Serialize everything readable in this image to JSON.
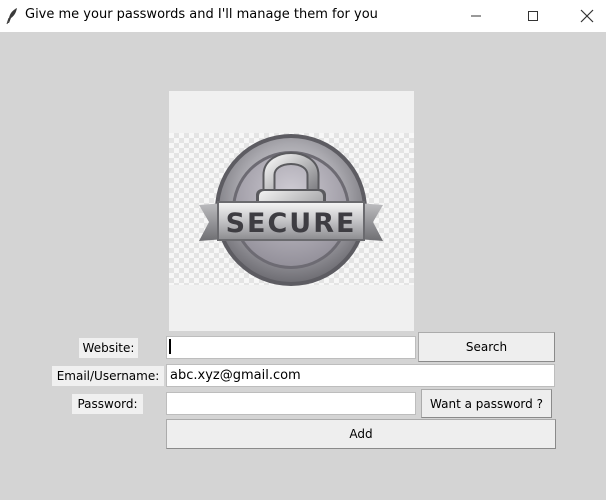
{
  "window": {
    "title": "Give me your passwords and I'll manage them for you"
  },
  "logo": {
    "text": "SECURE",
    "icon": "padlock-badge"
  },
  "form": {
    "website_label": "Website:",
    "website_value": "",
    "email_label": "Email/Username:",
    "email_value": "abc.xyz@gmail.com",
    "password_label": "Password:",
    "password_value": "",
    "search_button": "Search",
    "generate_button": "Want a password ?",
    "add_button": "Add"
  }
}
